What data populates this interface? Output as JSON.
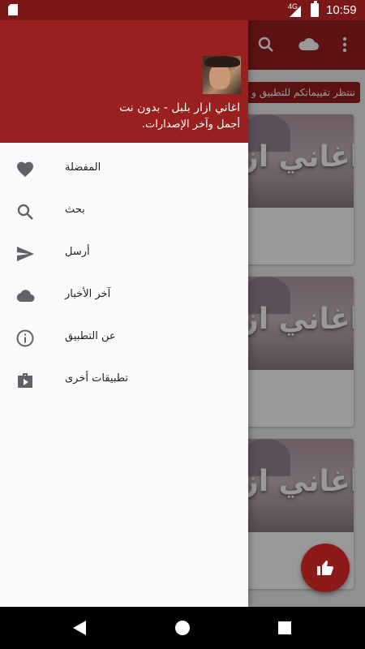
{
  "status_bar": {
    "network": "4G",
    "time": "10:59"
  },
  "toolbar": {
    "icons": [
      "search-icon",
      "cloud-icon",
      "more-vert-icon"
    ]
  },
  "marquee_text": "ننتظر تقييماتكم للتطبيق و",
  "cards": [
    {
      "title": "اغاني از"
    },
    {
      "title": "اغاني از"
    },
    {
      "title": "اغاني از"
    }
  ],
  "drawer": {
    "title": "اغاني ازار بلبل - بدون نت",
    "subtitle": "أجمل وآخر الإصدارات.",
    "items": [
      {
        "label": "المفضلة",
        "icon": "heart-icon"
      },
      {
        "label": "بحث",
        "icon": "search-icon"
      },
      {
        "label": "أرسل",
        "icon": "send-icon"
      },
      {
        "label": "آخر الأخبار",
        "icon": "cloud-icon"
      },
      {
        "label": "عن التطبيق",
        "icon": "info-icon"
      },
      {
        "label": "تطبيقات أخرى",
        "icon": "play-store-icon"
      }
    ]
  },
  "colors": {
    "primary": "#9a1f1f",
    "status_bar": "#7a1717",
    "icon_gray": "#5f6368"
  }
}
